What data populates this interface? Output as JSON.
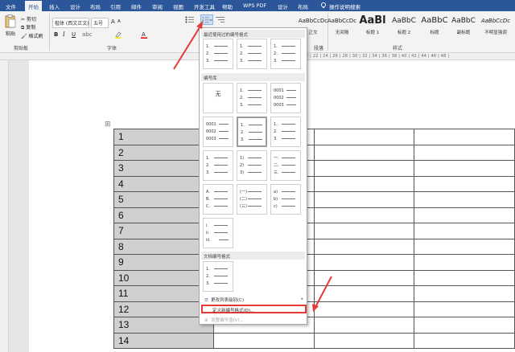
{
  "menu": {
    "tabs": [
      "文件",
      "开始",
      "插入",
      "设计",
      "布局",
      "引用",
      "邮件",
      "审阅",
      "视图",
      "开发工具",
      "帮助",
      "WPS PDF",
      "设计",
      "布局"
    ],
    "active_tab": "开始",
    "tell_me": "操作说明搜索"
  },
  "ribbon": {
    "clipboard": {
      "paste": "粘贴",
      "cut": "剪切",
      "copy": "复制",
      "format_painter": "格式刷",
      "label": "剪贴板"
    },
    "font": {
      "name": "楷体 (西文正文)",
      "size": "五号",
      "grow": "A",
      "shrink": "A",
      "bold": "B",
      "italic": "I",
      "underline": "U",
      "label": "字体"
    },
    "paragraph": {
      "label": "段落"
    },
    "styles": {
      "label": "样式",
      "items": [
        {
          "preview": "AaBbCcDc",
          "name": "正文"
        },
        {
          "preview": "AaBbCcDc",
          "name": "无间隔"
        },
        {
          "preview": "AaBl",
          "name": "标题 1"
        },
        {
          "preview": "AaBbC",
          "name": "标题 2"
        },
        {
          "preview": "AaBbC",
          "name": "标题"
        },
        {
          "preview": "AaBbC",
          "name": "副标题"
        },
        {
          "preview": "AaBbCcDc",
          "name": "不明显强调"
        }
      ]
    }
  },
  "ruler_scale": "2 | 22 | 24 | 26 | 28 | 30 | 32 | 34 | 36 | 38 | 40 | 42 | 44 | 46 | 48 |",
  "table": {
    "anchor": "⊞",
    "rows": [
      "1",
      "2",
      "3",
      "4",
      "5",
      "6",
      "7",
      "8",
      "9",
      "10",
      "11",
      "12",
      "13",
      "14"
    ]
  },
  "dropdown": {
    "recent_header": "最近使用过的编号格式",
    "library_header": "编号库",
    "doc_header": "文档编号格式",
    "none_label": "无",
    "cells": {
      "recent": [
        [
          "1.",
          "2.",
          "3."
        ],
        [
          "1.",
          "2.",
          "3."
        ],
        [
          "1.",
          "2.",
          "3."
        ]
      ],
      "library": [
        [
          "1.",
          "2.",
          "3."
        ],
        [
          "0001",
          "0002",
          "0003"
        ],
        [
          "0001",
          "0002",
          "0003"
        ],
        [
          "1.",
          "2.",
          "3."
        ],
        [
          "1.",
          "2.",
          "3."
        ],
        [
          "1.",
          "2.",
          "3."
        ],
        [
          "1)",
          "2)",
          "3)"
        ],
        [
          "一.",
          "二.",
          "三."
        ],
        [
          "A.",
          "B.",
          "C."
        ],
        [
          "(一)",
          "(二)",
          "(三)"
        ],
        [
          "a)",
          "b)",
          "c)"
        ],
        [
          "i.",
          "ii.",
          "iii."
        ]
      ],
      "document": [
        [
          "1.",
          "2.",
          "3."
        ]
      ]
    },
    "change_level": "更改列表级别(C)",
    "define_new": "定义新编号格式(D)...",
    "set_value": "设置编号值(V)..."
  },
  "colors": {
    "accent": "#2b579a",
    "highlight": "#e23a34",
    "shading": "#d0d0d0"
  }
}
